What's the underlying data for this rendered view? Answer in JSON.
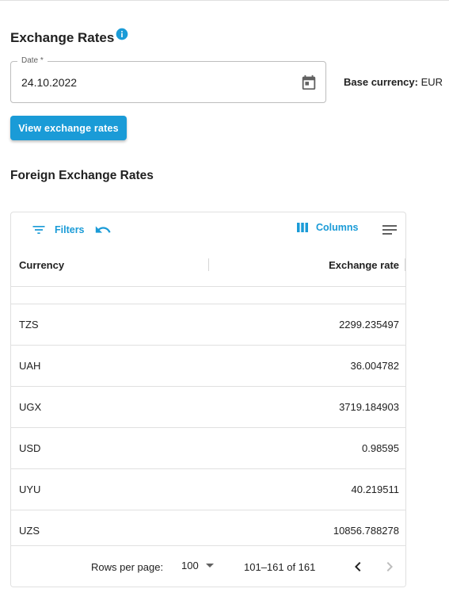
{
  "header": {
    "title": "Exchange Rates",
    "info_icon": "info-icon"
  },
  "form": {
    "date_label": "Date *",
    "date_value": "24.10.2022",
    "calendar_icon": "calendar-icon",
    "base_currency_label": "Base currency:",
    "base_currency_value": "EUR",
    "view_button_label": "View exchange rates"
  },
  "section": {
    "title": "Foreign Exchange Rates"
  },
  "grid": {
    "toolbar": {
      "filters_label": "Filters",
      "columns_label": "Columns",
      "icons": [
        "filter-icon",
        "reset-icon",
        "columns-icon",
        "density-icon"
      ]
    },
    "columns": [
      "Currency",
      "Exchange rate"
    ],
    "rows": [
      {
        "currency": "TZS",
        "rate": "2299.235497"
      },
      {
        "currency": "UAH",
        "rate": "36.004782"
      },
      {
        "currency": "UGX",
        "rate": "3719.184903"
      },
      {
        "currency": "USD",
        "rate": "0.98595"
      },
      {
        "currency": "UYU",
        "rate": "40.219511"
      },
      {
        "currency": "UZS",
        "rate": "10856.788278"
      }
    ],
    "footer": {
      "rows_per_page_label": "Rows per page:",
      "rows_per_page_value": "100",
      "page_range": "101–161 of 161"
    }
  },
  "colors": {
    "accent": "#1a9bd7",
    "text": "#212121",
    "divider": "#e0e0e0"
  }
}
